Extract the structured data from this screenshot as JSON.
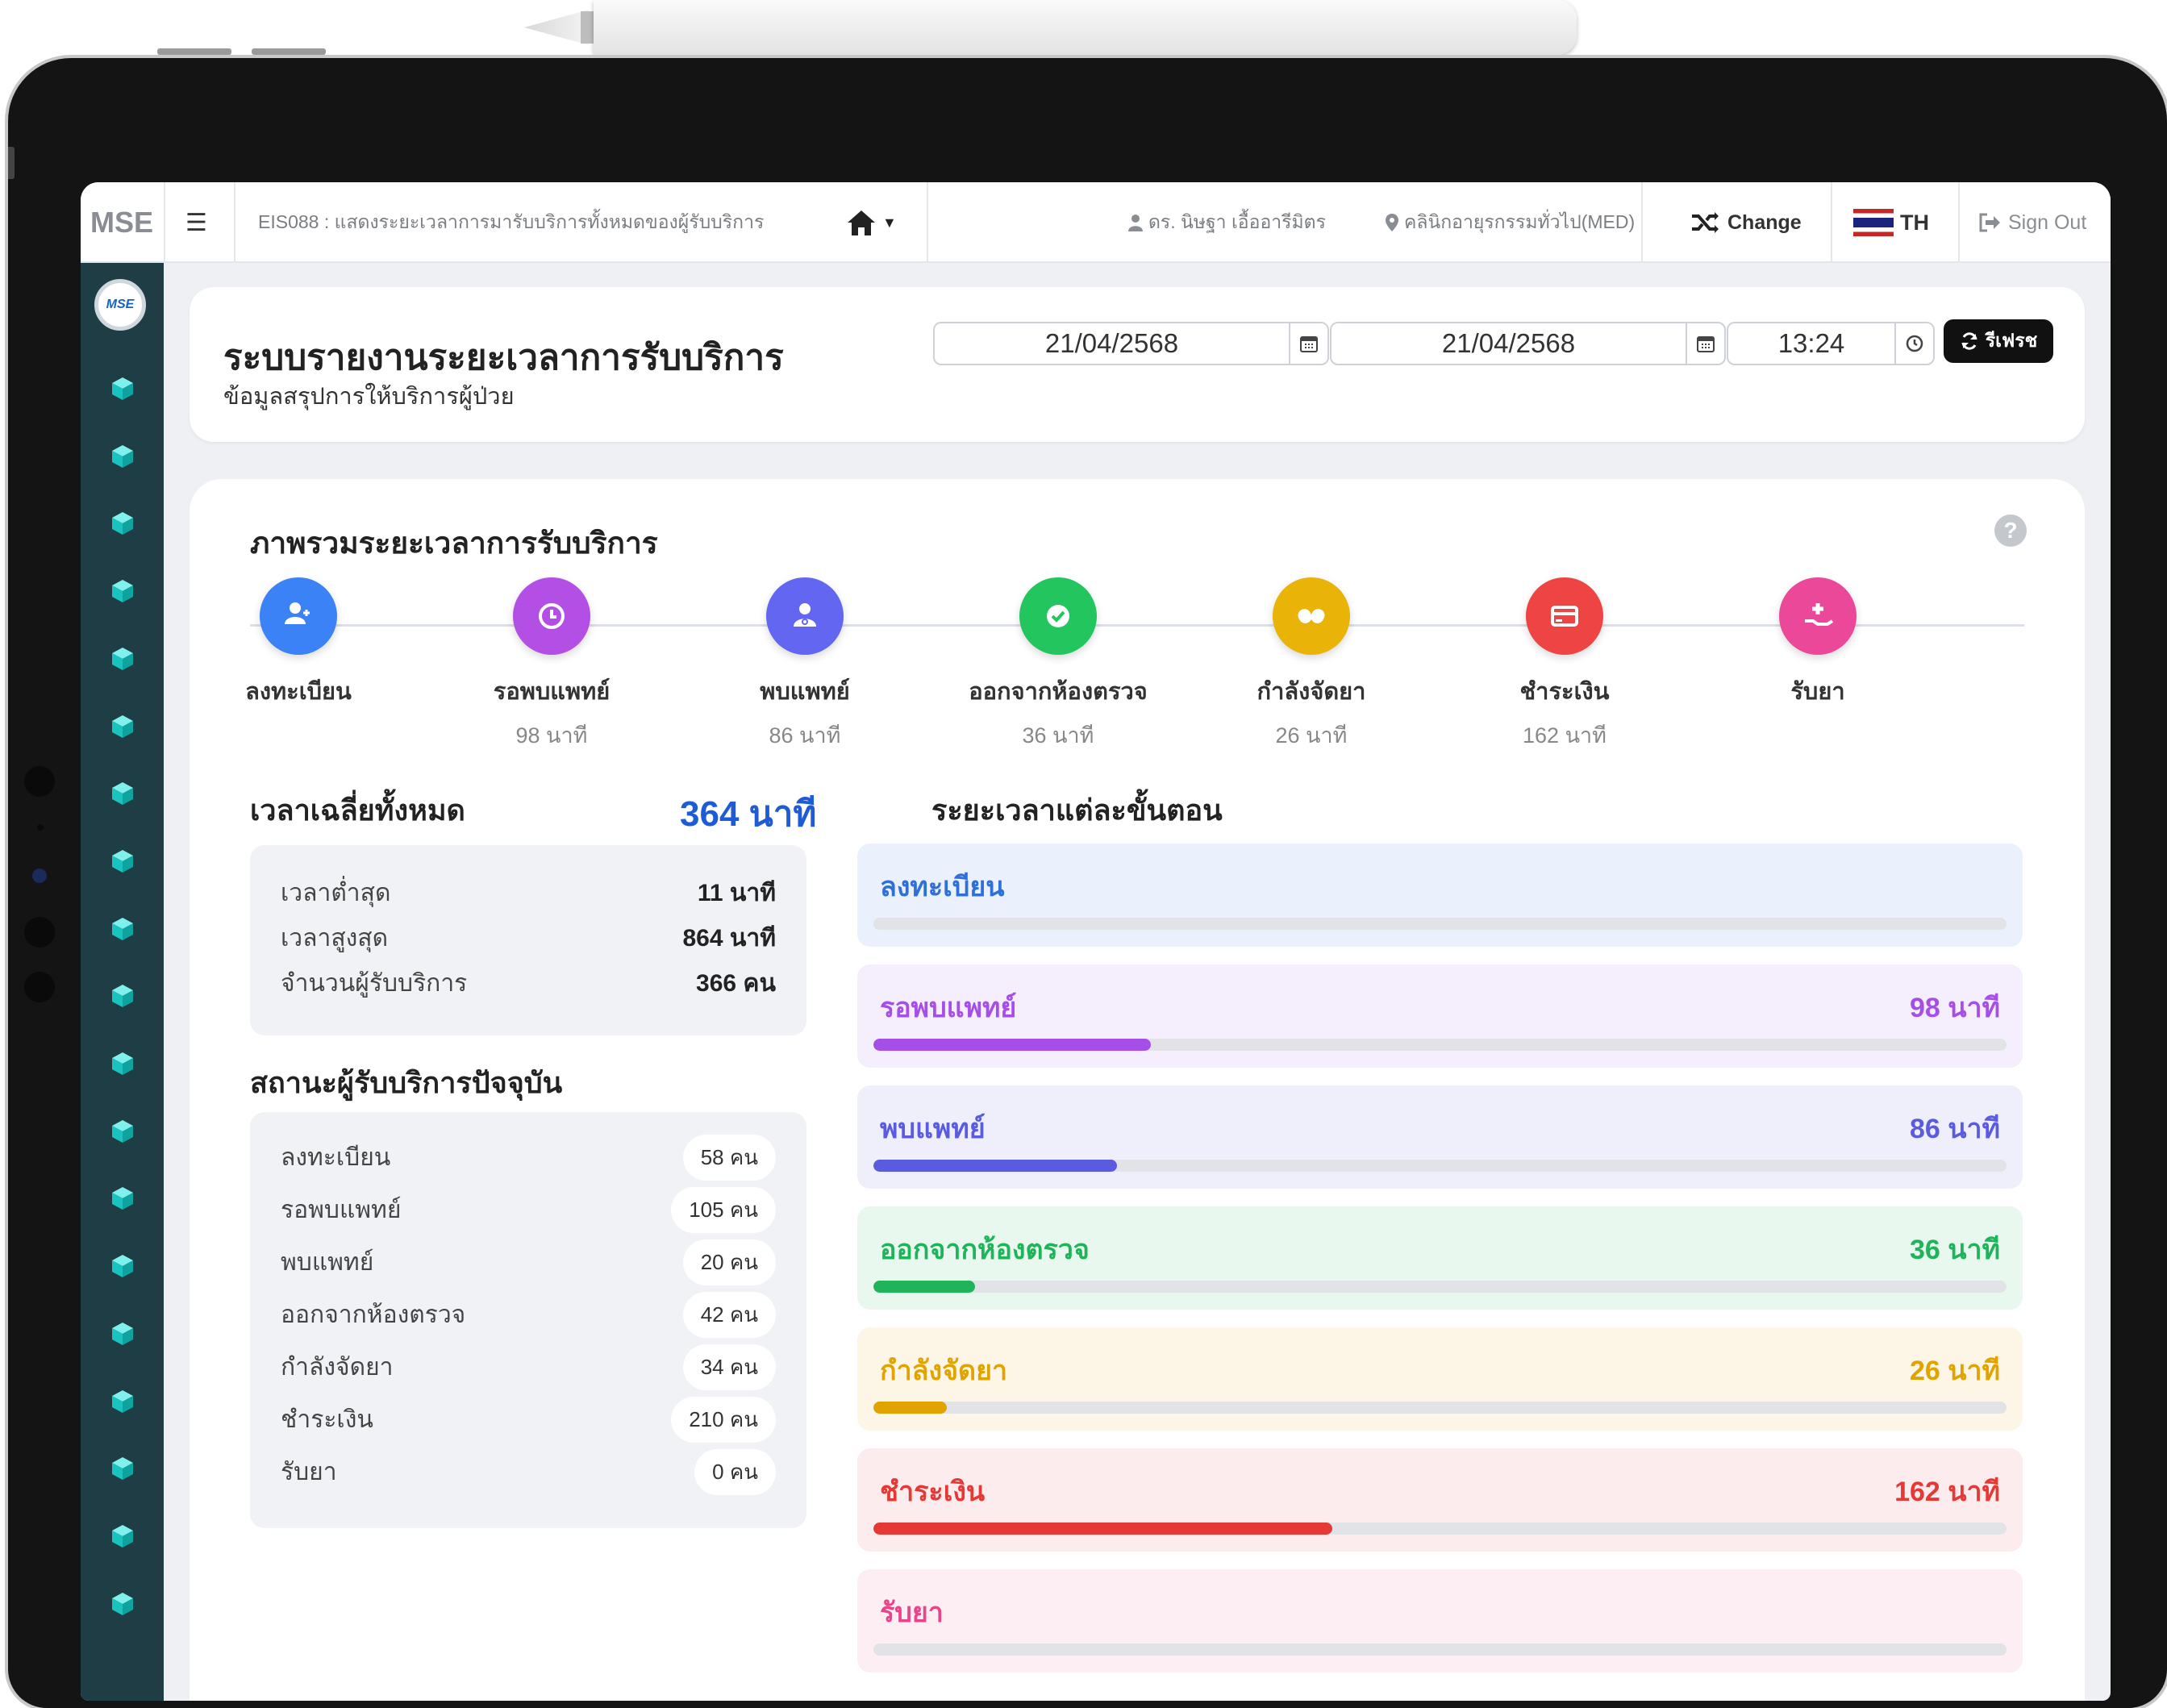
{
  "topbar": {
    "brand": "MSE",
    "breadcrumb": "EIS088 : แสดงระยะเวลาการมารับบริการทั้งหมดของผู้รับบริการ",
    "user": "ดร. นิษฐา เอื้ออารีมิตร",
    "clinic": "คลินิกอายุรกรรมทั่วไป(MED)",
    "change_label": "Change",
    "lang_label": "TH",
    "signout_label": "Sign Out"
  },
  "header": {
    "title": "ระบบรายงานระยะเวลาการรับบริการ",
    "subtitle": "ข้อมูลสรุปการให้บริการผู้ป่วย",
    "date_from": "21/04/2568",
    "date_to": "21/04/2568",
    "time": "13:24",
    "refresh_label": "รีเฟรช"
  },
  "overview": {
    "title": "ภาพรวมระยะเวลาการรับบริการ",
    "steps": [
      {
        "label": "ลงทะเบียน",
        "time": ""
      },
      {
        "label": "รอพบแพทย์",
        "time": "98 นาที"
      },
      {
        "label": "พบแพทย์",
        "time": "86 นาที"
      },
      {
        "label": "ออกจากห้องตรวจ",
        "time": "36 นาที"
      },
      {
        "label": "กำลังจัดยา",
        "time": "26 นาที"
      },
      {
        "label": "ชำระเงิน",
        "time": "162 นาที"
      },
      {
        "label": "รับยา",
        "time": ""
      }
    ]
  },
  "average": {
    "title": "เวลาเฉลี่ยทั้งหมด",
    "value": "364 นาที",
    "rows": [
      {
        "label": "เวลาต่ำสุด",
        "value": "11 นาที"
      },
      {
        "label": "เวลาสูงสุด",
        "value": "864 นาที"
      },
      {
        "label": "จำนวนผู้รับบริการ",
        "value": "366 คน"
      }
    ]
  },
  "status": {
    "title": "สถานะผู้รับบริการปัจจุบัน",
    "rows": [
      {
        "label": "ลงทะเบียน",
        "value": "58 คน"
      },
      {
        "label": "รอพบแพทย์",
        "value": "105 คน"
      },
      {
        "label": "พบแพทย์",
        "value": "20 คน"
      },
      {
        "label": "ออกจากห้องตรวจ",
        "value": "42 คน"
      },
      {
        "label": "กำลังจัดยา",
        "value": "34 คน"
      },
      {
        "label": "ชำระเงิน",
        "value": "210 คน"
      },
      {
        "label": "รับยา",
        "value": "0 คน"
      }
    ]
  },
  "stages": {
    "title": "ระยะเวลาแต่ละขั้นตอน",
    "items": [
      {
        "label": "ลงทะเบียน",
        "value": "",
        "minutes": 0,
        "color": "#2f6fd8",
        "bg": "#eaf1fd"
      },
      {
        "label": "รอพบแพทย์",
        "value": "98 นาที",
        "minutes": 98,
        "color": "#a64ee8",
        "bg": "#f5eefd"
      },
      {
        "label": "พบแพทย์",
        "value": "86 นาที",
        "minutes": 86,
        "color": "#5b5be0",
        "bg": "#efeffb"
      },
      {
        "label": "ออกจากห้องตรวจ",
        "value": "36 นาที",
        "minutes": 36,
        "color": "#1fb35a",
        "bg": "#e8f8ee"
      },
      {
        "label": "กำลังจัดยา",
        "value": "26 นาที",
        "minutes": 26,
        "color": "#e0a300",
        "bg": "#fdf6e6"
      },
      {
        "label": "ชำระเงิน",
        "value": "162 นาที",
        "minutes": 162,
        "color": "#e53935",
        "bg": "#fdeced"
      },
      {
        "label": "รับยา",
        "value": "",
        "minutes": 0,
        "color": "#e8448a",
        "bg": "#fdeef4"
      }
    ]
  },
  "colors": {
    "sidebar": "#1f3d45",
    "accent": "#1e5cd6",
    "register": "#3b82f6",
    "wait_doctor": "#b44fe5",
    "see_doctor": "#6366f1",
    "exit_room": "#22c55e",
    "dispense": "#eab308",
    "payment": "#ef4444",
    "receive": "#ec4899"
  }
}
